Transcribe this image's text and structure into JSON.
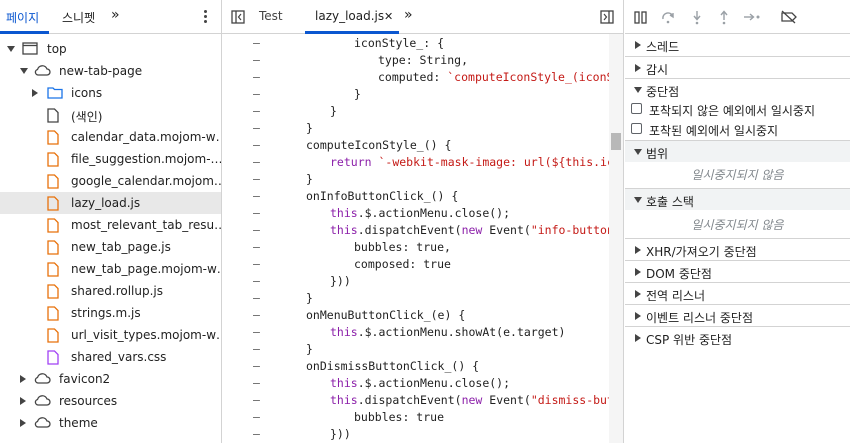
{
  "navigator": {
    "tabs": [
      "페이지",
      "스니펫"
    ],
    "more_tabs": "»",
    "tree": [
      {
        "label": "top",
        "icon": "frame-icon",
        "expanded": true
      },
      {
        "label": "new-tab-page",
        "icon": "cloud-icon",
        "expanded": true
      },
      {
        "label": "icons",
        "icon": "folder-icon",
        "expanded": false
      },
      {
        "label": "(색인)",
        "icon": "file-icon"
      },
      {
        "label": "calendar_data.mojom-w…",
        "icon": "file-js-icon"
      },
      {
        "label": "file_suggestion.mojom-…",
        "icon": "file-js-icon"
      },
      {
        "label": "google_calendar.mojom…",
        "icon": "file-js-icon"
      },
      {
        "label": "lazy_load.js",
        "icon": "file-js-icon",
        "selected": true
      },
      {
        "label": "most_relevant_tab_resu…",
        "icon": "file-js-icon"
      },
      {
        "label": "new_tab_page.js",
        "icon": "file-js-icon"
      },
      {
        "label": "new_tab_page.mojom-w…",
        "icon": "file-js-icon"
      },
      {
        "label": "shared.rollup.js",
        "icon": "file-js-icon"
      },
      {
        "label": "strings.m.js",
        "icon": "file-js-icon"
      },
      {
        "label": "url_visit_types.mojom-w…",
        "icon": "file-js-icon"
      },
      {
        "label": "shared_vars.css",
        "icon": "file-css-icon"
      },
      {
        "label": "favicon2",
        "icon": "cloud-icon",
        "expanded": false
      },
      {
        "label": "resources",
        "icon": "cloud-icon",
        "expanded": false
      },
      {
        "label": "theme",
        "icon": "cloud-icon",
        "expanded": false
      }
    ]
  },
  "editor": {
    "tabs": [
      "Test",
      "lazy_load.js"
    ],
    "more_tabs": "»",
    "close_glyph": "✕",
    "gutter_mark": "–",
    "lines": [
      {
        "indent": 2,
        "text": "iconStyle_: {"
      },
      {
        "indent": 3,
        "text": "type: String,"
      },
      {
        "indent": 3,
        "text": "computed: `computeIconStyle_(iconSrc)`"
      },
      {
        "indent": 2,
        "text": "}"
      },
      {
        "indent": 1,
        "text": "}"
      },
      {
        "indent": 0,
        "text": "}"
      },
      {
        "indent": 0,
        "text": "computeIconStyle_() {"
      },
      {
        "indent": 1,
        "text": "return `-webkit-mask-image: url(${this.iconSrc"
      },
      {
        "indent": 0,
        "text": "}"
      },
      {
        "indent": 0,
        "text": "onInfoButtonClick_() {"
      },
      {
        "indent": 1,
        "text": "this.$.actionMenu.close();"
      },
      {
        "indent": 1,
        "text": "this.dispatchEvent(new Event(\"info-button-clic"
      },
      {
        "indent": 2,
        "text": "bubbles: true,"
      },
      {
        "indent": 2,
        "text": "composed: true"
      },
      {
        "indent": 1,
        "text": "}))"
      },
      {
        "indent": 0,
        "text": "}"
      },
      {
        "indent": 0,
        "text": "onMenuButtonClick_(e) {"
      },
      {
        "indent": 1,
        "text": "this.$.actionMenu.showAt(e.target)"
      },
      {
        "indent": 0,
        "text": "}"
      },
      {
        "indent": 0,
        "text": "onDismissButtonClick_() {"
      },
      {
        "indent": 1,
        "text": "this.$.actionMenu.close();"
      },
      {
        "indent": 1,
        "text": "this.dispatchEvent(new Event(\"dismiss-button-c"
      },
      {
        "indent": 2,
        "text": "bubbles: true"
      },
      {
        "indent": 1,
        "text": "}))"
      },
      {
        "indent": 0,
        "text": "}"
      }
    ]
  },
  "debugger": {
    "toolbar_icons": [
      "pause-icon",
      "step-over-icon",
      "step-into-icon",
      "step-out-icon",
      "step-icon",
      "deactivate-breakpoints-icon"
    ],
    "sections": [
      {
        "label": "스레드",
        "expanded": false
      },
      {
        "label": "감시",
        "expanded": false
      },
      {
        "label": "중단점",
        "expanded": true
      }
    ],
    "breakpoint_options": [
      "포착되지 않은 예외에서 일시중지",
      "포착된 예외에서 일시중지"
    ],
    "scope_label": "범위",
    "scope_empty": "일시중지되지 않음",
    "callstack_label": "호출 스택",
    "callstack_empty": "일시중지되지 않음",
    "more_sections": [
      "XHR/가져오기 중단점",
      "DOM 중단점",
      "전역 리스너",
      "이벤트 리스너 중단점",
      "CSP 위반 중단점"
    ]
  }
}
